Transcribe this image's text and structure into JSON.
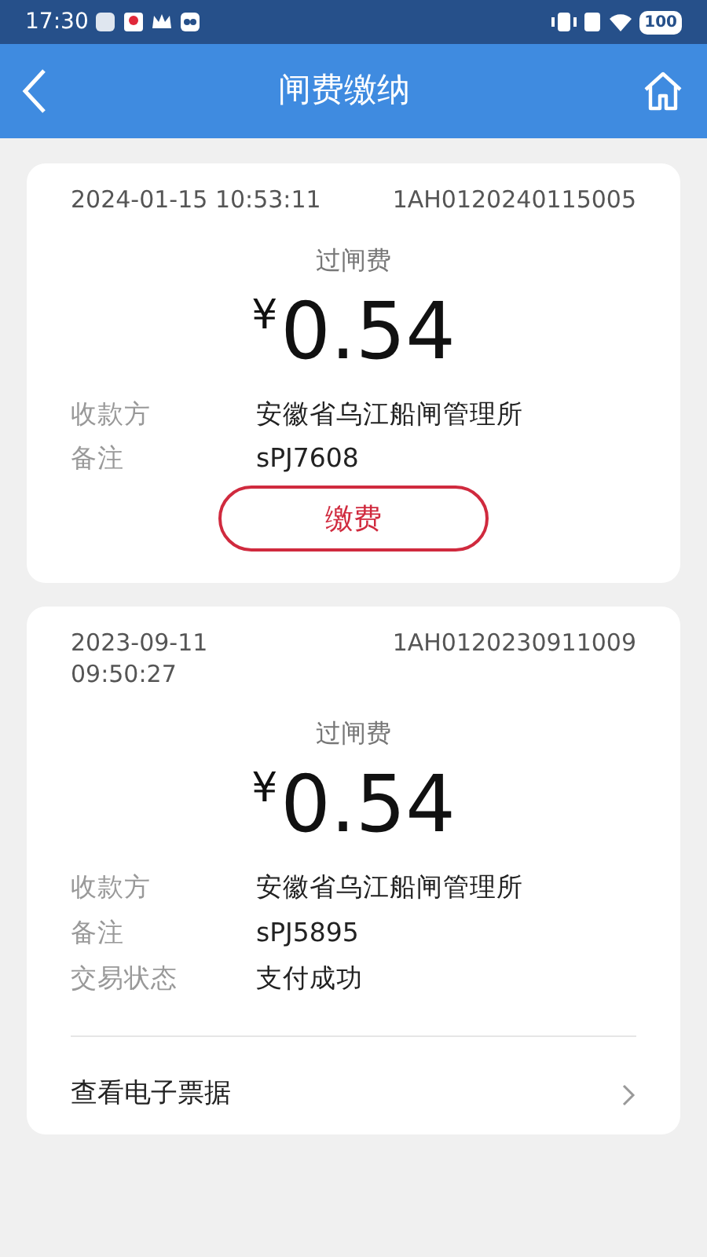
{
  "status_bar": {
    "time": "17:30",
    "battery": "100"
  },
  "header": {
    "title": "闸费缴纳"
  },
  "records": [
    {
      "datetime": "2024-01-15 10:53:11",
      "number": "1AH0120240115005",
      "fee_type": "过闸费",
      "currency": "¥",
      "amount": "0.54",
      "details": [
        {
          "label": "收款方",
          "value": "安徽省乌江船闸管理所"
        },
        {
          "label": "备注",
          "value": "sPJ7608"
        }
      ],
      "button": "缴费"
    },
    {
      "datetime": "2023-09-11\n09:50:27",
      "number": "1AH0120230911009",
      "fee_type": "过闸费",
      "currency": "¥",
      "amount": "0.54",
      "details": [
        {
          "label": "收款方",
          "value": "安徽省乌江船闸管理所"
        },
        {
          "label": "备注",
          "value": "sPJ5895"
        },
        {
          "label": "交易状态",
          "value": "支付成功"
        }
      ],
      "link": "查看电子票据"
    }
  ]
}
